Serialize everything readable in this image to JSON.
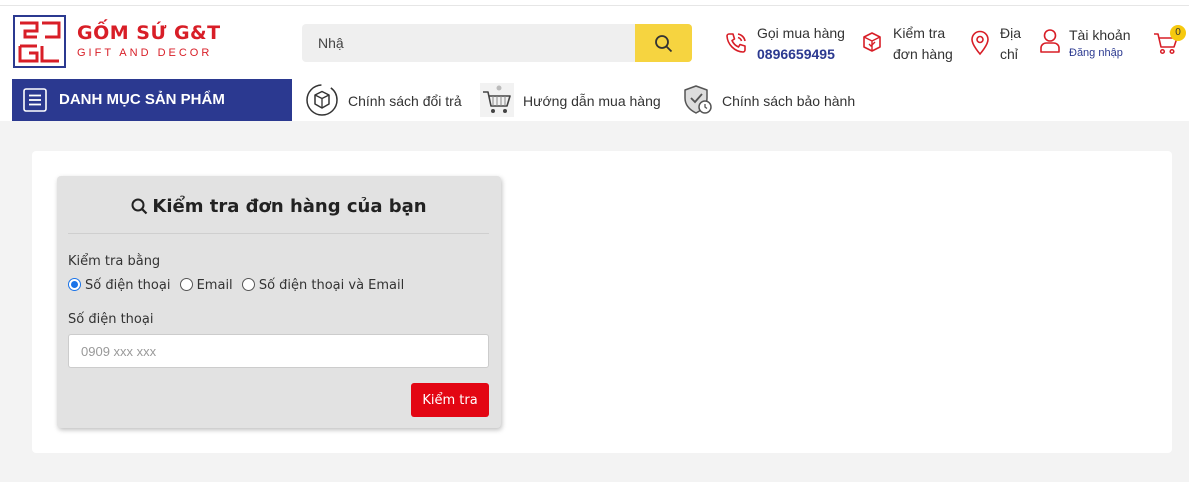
{
  "logo": {
    "name": "GỐM SỨ G&T",
    "tagline": "GIFT AND DECOR"
  },
  "search": {
    "value": "Nhậ"
  },
  "header_items": {
    "hotline_label": "Gọi mua hàng",
    "hotline_number": "0896659495",
    "order_check_line1": "Kiểm tra",
    "order_check_line2": "đơn hàng",
    "address_line1": "Địa",
    "address_line2": "chỉ",
    "account_label": "Tài khoản",
    "account_sub": "Đăng nhập",
    "cart_count": "0"
  },
  "category_nav": {
    "label": "DANH MỤC SẢN PHẨM"
  },
  "policy_links": [
    {
      "label": "Chính sách đổi trả",
      "icon": "box-return-icon"
    },
    {
      "label": "Hướng dẫn mua hàng",
      "icon": "shopping-cart-icon"
    },
    {
      "label": "Chính sách bảo hành",
      "icon": "shield-clock-icon"
    }
  ],
  "order_form": {
    "title": "Kiểm tra đơn hàng của bạn",
    "check_by_label": "Kiểm tra bằng",
    "options": [
      {
        "label": "Số điện thoại",
        "selected": true
      },
      {
        "label": "Email",
        "selected": false
      },
      {
        "label": "Số điện thoại và Email",
        "selected": false
      }
    ],
    "phone_label": "Số điện thoại",
    "phone_placeholder": "0909 xxx xxx",
    "submit_label": "Kiểm tra"
  },
  "colors": {
    "brand_red": "#d81e27",
    "brand_blue": "#2b3990",
    "search_button": "#f6d440",
    "submit_button": "#e30613",
    "radio_selected": "#1a73e8"
  }
}
